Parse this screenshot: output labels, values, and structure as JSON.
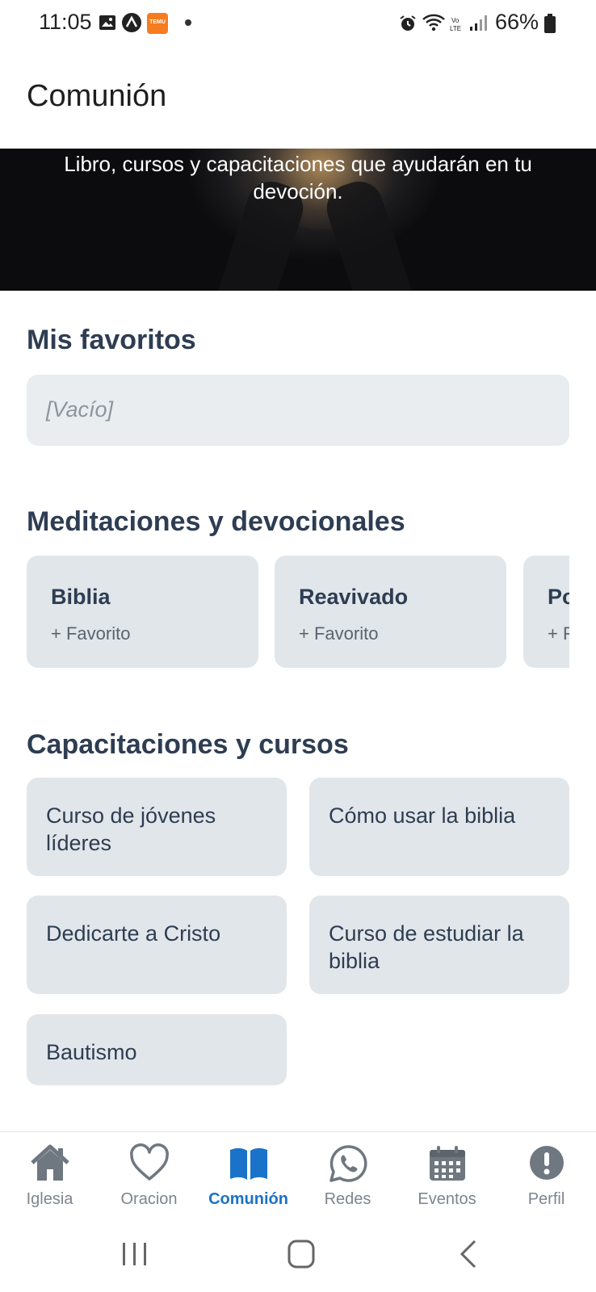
{
  "status_bar": {
    "time": "11:05",
    "battery": "66%",
    "icons": [
      "image-icon",
      "app-a-icon",
      "temu-icon",
      "alarm-icon",
      "wifi-icon",
      "volte-icon",
      "signal-icon",
      "battery-icon"
    ],
    "temu_label": "TEMU"
  },
  "header": {
    "title": "Comunión"
  },
  "hero": {
    "text": "Libro, cursos y capacitaciones que ayudarán en tu devoción."
  },
  "favorites": {
    "title": "Mis favoritos",
    "empty_text": "[Vacío]"
  },
  "meditations": {
    "title": "Meditaciones y devocionales",
    "cards": [
      {
        "title": "Biblia",
        "action": "+ Favorito"
      },
      {
        "title": "Reavivado",
        "action": "+ Favorito"
      },
      {
        "title": "Po",
        "action": "+ F"
      }
    ]
  },
  "courses": {
    "title": "Capacitaciones y cursos",
    "items": [
      "Curso de jóvenes líderes",
      "Cómo usar la biblia",
      "Dedicarte a Cristo",
      "Curso de estudiar la biblia",
      "Bautismo"
    ]
  },
  "tabbar": {
    "active_color": "#1a73c9",
    "inactive_color": "#7d858f",
    "tabs": [
      {
        "label": "Iglesia",
        "icon": "home-icon"
      },
      {
        "label": "Oracion",
        "icon": "heart-icon"
      },
      {
        "label": "Comunión",
        "icon": "book-icon",
        "active": true
      },
      {
        "label": "Redes",
        "icon": "whatsapp-icon"
      },
      {
        "label": "Eventos",
        "icon": "calendar-icon"
      },
      {
        "label": "Perfil",
        "icon": "alert-icon"
      }
    ]
  },
  "system_nav": {
    "buttons": [
      "recents-icon",
      "home-button-icon",
      "back-icon"
    ]
  }
}
